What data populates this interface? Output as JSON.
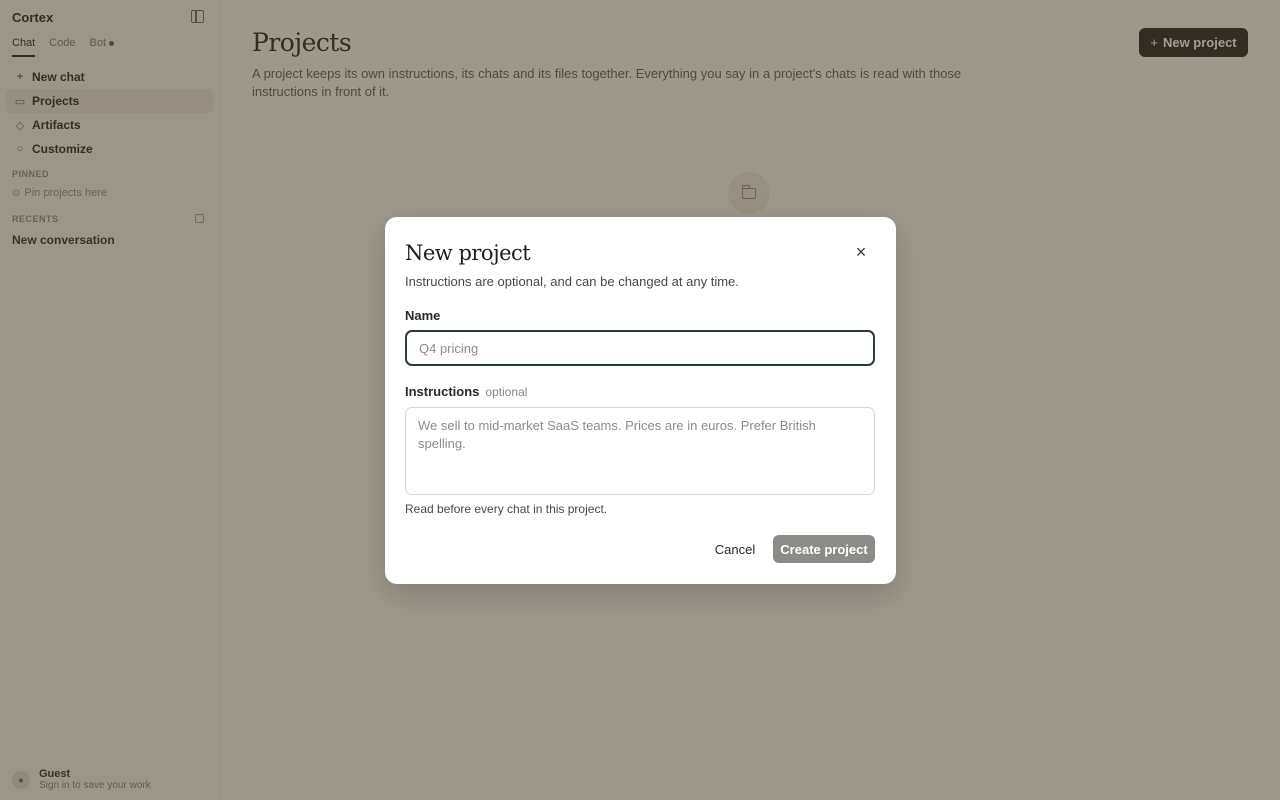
{
  "sidebar": {
    "brand": "Cortex",
    "tabs": [
      {
        "label": "Chat"
      },
      {
        "label": "Code"
      },
      {
        "label": "Bot"
      }
    ],
    "nav": [
      {
        "label": "New chat",
        "icon": "plus-icon"
      },
      {
        "label": "Projects",
        "icon": "folder-icon"
      },
      {
        "label": "Artifacts",
        "icon": "shapes-icon"
      },
      {
        "label": "Customize",
        "icon": "settings-icon"
      }
    ],
    "pinned_label": "PINNED",
    "pinned_empty": "Pin projects here",
    "recents_label": "RECENTS",
    "recents": [
      {
        "label": "New conversation"
      }
    ],
    "user_name": "Guest",
    "user_sub": "Sign in to save your work"
  },
  "main": {
    "title": "Projects",
    "description": "A project keeps its own instructions, its chats and its files together. Everything you say in a project's chats is read with those instructions in front of it.",
    "new_project_label": "New project"
  },
  "modal": {
    "title": "New project",
    "subtitle": "Instructions are optional, and can be changed at any time.",
    "name_label": "Name",
    "name_placeholder": "Q4 pricing",
    "instructions_label": "Instructions",
    "instructions_optional": "optional",
    "instructions_placeholder": "We sell to mid-market SaaS teams. Prices are in euros. Prefer British spelling.",
    "instructions_help": "Read before every chat in this project.",
    "cancel_label": "Cancel",
    "create_label": "Create project"
  },
  "colors": {
    "overlay": "#463c28",
    "primary_button": "#1f1e1b",
    "disabled_button": "#8c8b87",
    "focus_border": "#2a3b33"
  }
}
